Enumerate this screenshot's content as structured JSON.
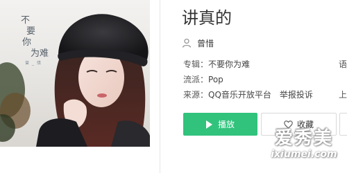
{
  "album_cover": {
    "text_lines": [
      "不",
      "要",
      "你",
      "为难"
    ],
    "mark": "曾 _ 惜"
  },
  "song": {
    "title": "讲真的",
    "singer": "曾惜"
  },
  "meta": {
    "album_label": "专辑：",
    "album_value": "不要你为难",
    "genre_label": "流派：",
    "genre_value": "Pop",
    "source_label": "来源：",
    "source_value": "QQ音乐开放平台",
    "report_label": "举报投诉",
    "cut_row1": "语",
    "cut_row3": "上"
  },
  "buttons": {
    "play_label": "播放",
    "favorite_label": "收藏"
  },
  "watermark": {
    "cn": "爱秀美",
    "en": "ixiumei.com"
  },
  "icons": {
    "singer": "person-icon",
    "play": "play-icon",
    "favorite": "heart-icon"
  },
  "colors": {
    "play_button": "#31c27c",
    "cover_text": "#556069"
  }
}
